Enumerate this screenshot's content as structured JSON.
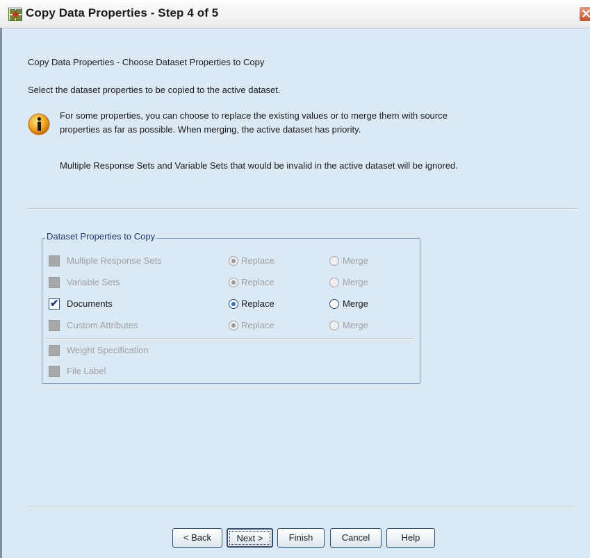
{
  "window": {
    "title": "Copy Data Properties - Step 4 of 5",
    "close_glyph": "✕"
  },
  "content": {
    "heading": "Copy Data Properties - Choose Dataset Properties to Copy",
    "instruction": "Select the dataset properties to be copied to the active dataset.",
    "info_line1": "For some properties, you can choose to replace the existing values or to merge them with source",
    "info_line2": "properties as far as possible.  When merging, the active dataset has priority.",
    "note": "Multiple Response Sets and Variable Sets that would be invalid in the active dataset will be ignored."
  },
  "group": {
    "label": "Dataset Properties to Copy",
    "rows": [
      {
        "label": "Multiple Response Sets",
        "checked": false,
        "enabled": false,
        "replace": "Replace",
        "merge": "Merge",
        "selected": "replace"
      },
      {
        "label": "Variable Sets",
        "checked": false,
        "enabled": false,
        "replace": "Replace",
        "merge": "Merge",
        "selected": "replace"
      },
      {
        "label": "Documents",
        "checked": true,
        "enabled": true,
        "replace": "Replace",
        "merge": "Merge",
        "selected": "replace"
      },
      {
        "label": "Custom Attributes",
        "checked": false,
        "enabled": false,
        "replace": "Replace",
        "merge": "Merge",
        "selected": "replace"
      }
    ],
    "extra": [
      {
        "label": "Weight Specification",
        "checked": false,
        "enabled": false
      },
      {
        "label": "File Label",
        "checked": false,
        "enabled": false
      }
    ]
  },
  "buttons": {
    "back": "< Back",
    "next": "Next >",
    "finish": "Finish",
    "cancel": "Cancel",
    "help": "Help"
  },
  "colors": {
    "background": "#dbe9f5",
    "group_label": "#1e3a6e",
    "disabled_text": "#a0a0a0",
    "radio_selected": "#2a6fd6"
  },
  "icons": {
    "app": "spss-grid-plus-icon",
    "info": "info-icon",
    "close": "close-icon"
  }
}
